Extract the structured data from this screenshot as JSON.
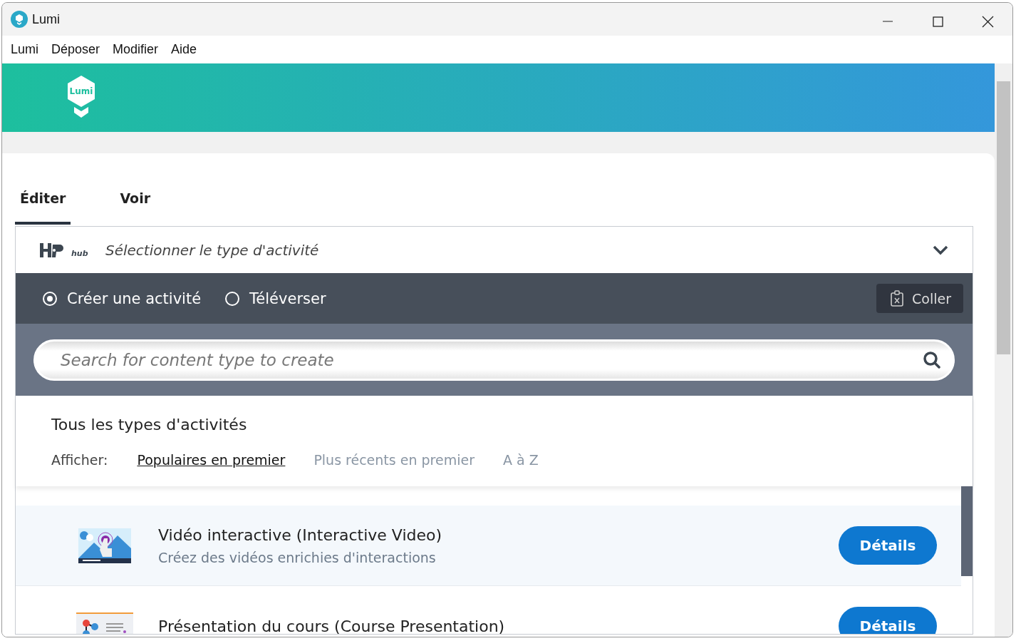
{
  "window": {
    "title": "Lumi"
  },
  "menu": [
    "Lumi",
    "Déposer",
    "Modifier",
    "Aide"
  ],
  "banner": {
    "logo_text": "Lumi"
  },
  "tabs": [
    {
      "label": "Éditer",
      "selected": true
    },
    {
      "label": "Voir",
      "selected": false
    }
  ],
  "hub": {
    "logo_text": "hub",
    "title": "Sélectionner le type d'activité",
    "expanded": true,
    "modes": [
      {
        "label": "Créer une activité",
        "selected": true
      },
      {
        "label": "Téléverser",
        "selected": false
      }
    ],
    "paste_button": "Coller",
    "search": {
      "placeholder": "Search for content type to create"
    },
    "section_title": "Tous les types d'activités",
    "sort_label": "Afficher:",
    "sort_options": [
      {
        "label": "Populaires en premier",
        "selected": true
      },
      {
        "label": "Plus récents en premier",
        "selected": false
      },
      {
        "label": "A à Z",
        "selected": false
      }
    ],
    "content_types": [
      {
        "kind": "video",
        "title": "Vidéo interactive (Interactive Video)",
        "description": "Créez des vidéos enrichies d'interactions",
        "button": "Détails"
      },
      {
        "kind": "presentation",
        "title": "Présentation du cours (Course Presentation)",
        "button": "Détails"
      }
    ]
  }
}
